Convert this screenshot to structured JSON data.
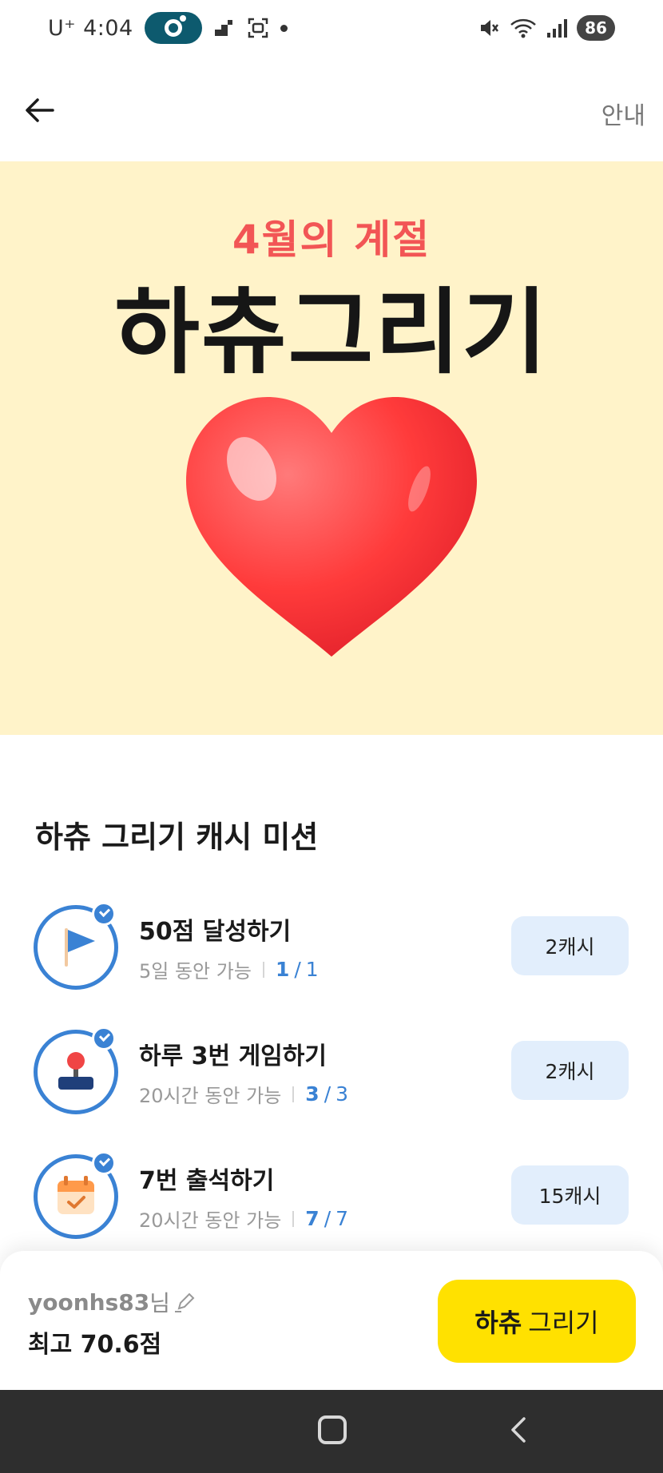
{
  "status_bar": {
    "time": "U⁺ 4:04",
    "battery": "86"
  },
  "header": {
    "guide_label": "안내"
  },
  "banner": {
    "subtitle": "4월의 계절",
    "title": "하츄그리기"
  },
  "missions": {
    "title": "하츄 그리기 캐시 미션",
    "items": [
      {
        "name": "50점 달성하기",
        "period": "5일 동안 가능",
        "done": "1",
        "total": "1",
        "reward": "2캐시",
        "icon": "flag-icon"
      },
      {
        "name": "하루 3번 게임하기",
        "period": "20시간 동안 가능",
        "done": "3",
        "total": "3",
        "reward": "2캐시",
        "icon": "joystick-icon"
      },
      {
        "name": "7번 출석하기",
        "period": "20시간 동안 가능",
        "done": "7",
        "total": "7",
        "reward": "15캐시",
        "icon": "calendar-icon"
      }
    ]
  },
  "profile": {
    "username": "yoonhs83",
    "suffix": "님",
    "best_score": "최고 70.6점"
  },
  "play_button": {
    "bold": "하츄",
    "rest": "그리기"
  },
  "colors": {
    "accent_blue": "#3a82d4",
    "banner_bg": "#fff3c9",
    "button_yellow": "#ffe100",
    "reward_bg": "#e2eefc"
  }
}
